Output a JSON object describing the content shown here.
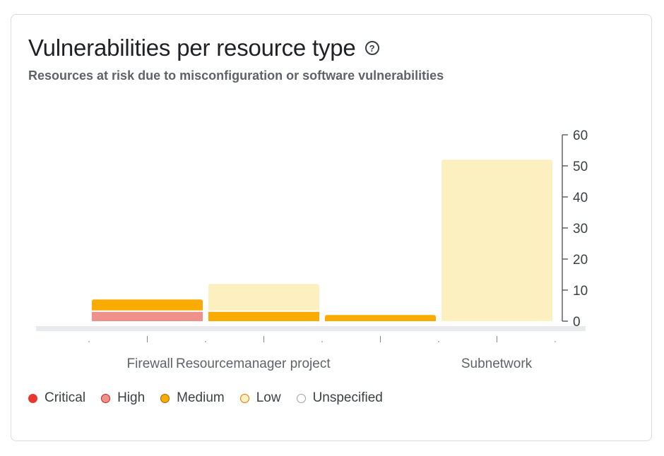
{
  "card": {
    "title": "Vulnerabilities per resource type",
    "help_icon": "question-circle-icon",
    "help_glyph": "?",
    "subtitle": "Resources at risk due to misconfiguration or software vulnerabilities"
  },
  "chart_data": {
    "type": "bar",
    "stacked": true,
    "categories": [
      "Firewall",
      "Resourcemanager project",
      "",
      "Subnetwork"
    ],
    "y_axis_position": "right",
    "ylim": [
      0,
      60
    ],
    "yticks": [
      0,
      10,
      20,
      30,
      40,
      50,
      60
    ],
    "series": [
      {
        "name": "Critical",
        "color": "#e8372c",
        "values": [
          0,
          0,
          0,
          0
        ]
      },
      {
        "name": "High",
        "color": "#ee918a",
        "values": [
          3,
          0,
          0,
          0
        ]
      },
      {
        "name": "Medium",
        "color": "#f9ab00",
        "values": [
          4,
          3,
          2,
          0
        ]
      },
      {
        "name": "Low",
        "color": "#fcefc0",
        "values": [
          0,
          9,
          0,
          52
        ]
      },
      {
        "name": "Unspecified",
        "color": "#ffffff",
        "values": [
          0,
          0,
          0,
          0
        ]
      }
    ],
    "legend_position": "bottom-left",
    "legend_borders": {
      "Critical": "#e8372c",
      "High": "#c5221f",
      "Medium": "#b06000",
      "Low": "#e37400",
      "Unspecified": "#9aa0a6"
    }
  }
}
